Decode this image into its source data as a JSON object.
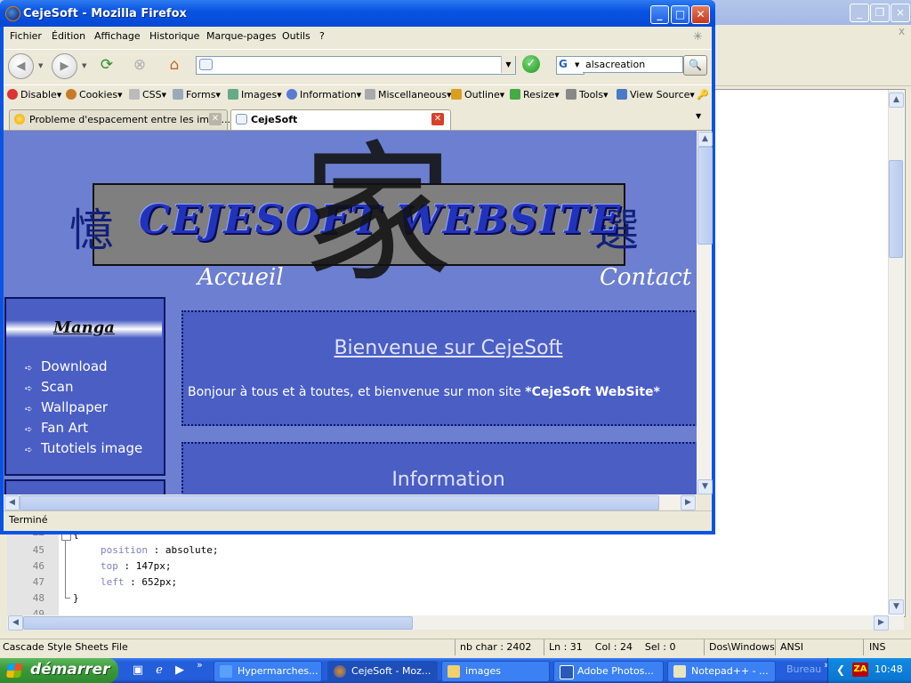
{
  "notepad": {
    "x_label": "x",
    "code_lines": [
      {
        "line": "44",
        "text": "{"
      },
      {
        "line": "45",
        "prop": "position",
        "value": " : absolute;"
      },
      {
        "line": "46",
        "prop": "top",
        "value": " : 147px;"
      },
      {
        "line": "47",
        "prop": "left",
        "value": " : 652px;"
      },
      {
        "line": "48",
        "text": "}"
      },
      {
        "line": "49",
        "text": ""
      }
    ],
    "status": {
      "file_type": "Cascade Style Sheets File",
      "nb_char": "nb char : 2402",
      "position": "Ln : 31    Col : 24    Sel : 0",
      "eol": "Dos\\Windows",
      "encoding": "ANSI",
      "mode": "INS"
    }
  },
  "firefox": {
    "title": "CejeSoft - Mozilla Firefox",
    "menu": [
      "Fichier",
      "Édition",
      "Affichage",
      "Historique",
      "Marque-pages",
      "Outils",
      "?"
    ],
    "url": "",
    "search_value": "alsacreation",
    "search_engine": "G",
    "webdev": [
      "Disable",
      "Cookies",
      "CSS",
      "Forms",
      "Images",
      "Information",
      "Miscellaneous",
      "Outline",
      "Resize",
      "Tools",
      "View Source"
    ],
    "tabs": [
      {
        "label": "Probleme d'espacement entre les imag...",
        "active": false
      },
      {
        "label": "CejeSoft",
        "active": true
      }
    ],
    "status": "Terminé"
  },
  "page": {
    "site_title": "CEJESOFT WEBSITE",
    "kanji_left": "憶",
    "kanji_center": "家",
    "kanji_right": "選",
    "nav": [
      "Accueil",
      "Contact"
    ],
    "sidebar_title": "Manga",
    "sidebar_items": [
      "Download",
      "Scan",
      "Wallpaper",
      "Fan Art",
      "Tutotiels image"
    ],
    "welcome_title": "Bienvenue sur CejeSoft",
    "welcome_text": "Bonjour à tous et à toutes, et bienvenue sur mon site ",
    "welcome_site": "*CejeSoft WebSite*",
    "info_title": "Information"
  },
  "taskbar": {
    "start": "démarrer",
    "tasks": [
      {
        "label": "Hypermarches...",
        "icon": "ie-icon",
        "active": false
      },
      {
        "label": "CejeSoft - Moz...",
        "icon": "firefox-icon",
        "active": true
      },
      {
        "label": "images",
        "icon": "folder-icon",
        "active": false
      },
      {
        "label": "Adobe Photos...",
        "icon": "photoshop-icon",
        "active": false
      },
      {
        "label": "Notepad++ - ...",
        "icon": "notepad-icon",
        "active": false
      }
    ],
    "bureau": "Bureau",
    "clock": "10:48"
  },
  "colors": {
    "page_bg": "#6d7fd0",
    "box_bg": "#4a5ec4",
    "title_blue": "#2233bb",
    "xp_blue": "#0a54e3"
  }
}
